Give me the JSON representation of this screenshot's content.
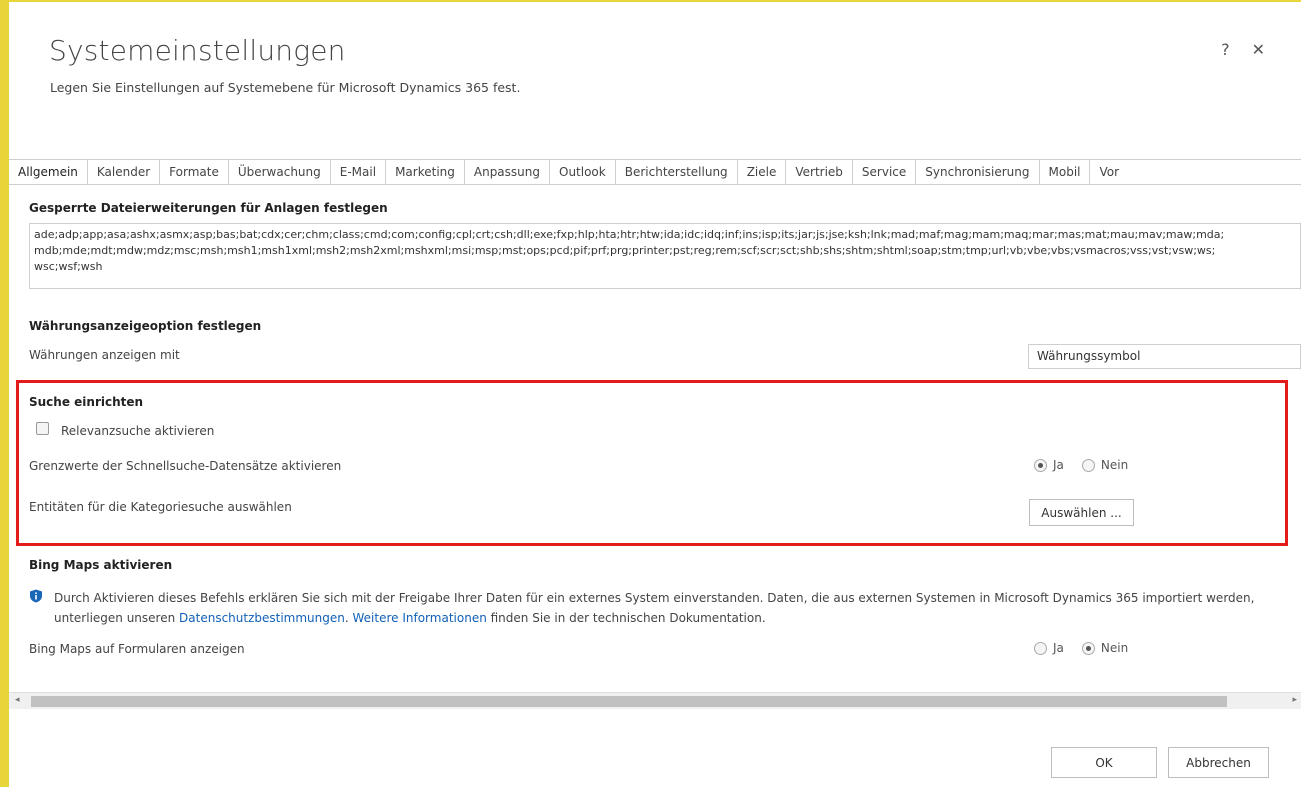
{
  "dialog": {
    "title": "Systemeinstellungen",
    "subtitle": "Legen Sie Einstellungen auf Systemebene für Microsoft Dynamics 365 fest.",
    "help_label": "?",
    "close_label": "✕"
  },
  "tabs": [
    {
      "label": "Allgemein",
      "active": true
    },
    {
      "label": "Kalender"
    },
    {
      "label": "Formate"
    },
    {
      "label": "Überwachung"
    },
    {
      "label": "E-Mail"
    },
    {
      "label": "Marketing"
    },
    {
      "label": "Anpassung"
    },
    {
      "label": "Outlook"
    },
    {
      "label": "Berichterstellung"
    },
    {
      "label": "Ziele"
    },
    {
      "label": "Vertrieb"
    },
    {
      "label": "Service"
    },
    {
      "label": "Synchronisierung"
    },
    {
      "label": "Mobil"
    },
    {
      "label": "Vor"
    }
  ],
  "blocked_extensions": {
    "title": "Gesperrte Dateierweiterungen für Anlagen festlegen",
    "value": "ade;adp;app;asa;ashx;asmx;asp;bas;bat;cdx;cer;chm;class;cmd;com;config;cpl;crt;csh;dll;exe;fxp;hlp;hta;htr;htw;ida;idc;idq;inf;ins;isp;its;jar;js;jse;ksh;lnk;mad;maf;mag;mam;maq;mar;mas;mat;mau;mav;maw;mda;\nmdb;mde;mdt;mdw;mdz;msc;msh;msh1;msh1xml;msh2;msh2xml;mshxml;msi;msp;mst;ops;pcd;pif;prf;prg;printer;pst;reg;rem;scf;scr;sct;shb;shs;shtm;shtml;soap;stm;tmp;url;vb;vbe;vbs;vsmacros;vss;vst;vsw;ws;\nwsc;wsf;wsh"
  },
  "currency": {
    "title": "Währungsanzeigeoption festlegen",
    "label": "Währungen anzeigen mit",
    "selected": "Währungssymbol"
  },
  "search": {
    "title": "Suche einrichten",
    "relevance_label": "Relevanzsuche aktivieren",
    "relevance_checked": false,
    "quickfind_label": "Grenzwerte der Schnellsuche-Datensätze aktivieren",
    "quickfind_yes": "Ja",
    "quickfind_no": "Nein",
    "quickfind_value": "Ja",
    "category_label": "Entitäten für die Kategoriesuche auswählen",
    "select_button": "Auswählen ..."
  },
  "bing": {
    "title": "Bing Maps aktivieren",
    "info_part1": "Durch Aktivieren dieses Befehls erklären Sie sich mit der Freigabe Ihrer Daten für ein externes System einverstanden. Daten, die aus externen Systemen in Microsoft Dynamics 365 importiert werden, unterliegen unseren ",
    "privacy_link": "Datenschutzbestimmungen",
    "info_part2": ". ",
    "more_link": "Weitere Informationen",
    "info_part3": " finden Sie in der technischen Dokumentation.",
    "forms_label": "Bing Maps auf Formularen anzeigen",
    "forms_yes": "Ja",
    "forms_no": "Nein",
    "forms_value": "Nein"
  },
  "footer": {
    "ok_label": "OK",
    "cancel_label": "Abbrechen"
  },
  "colors": {
    "highlight": "#e31b1b",
    "link": "#1160b7",
    "frame": "#e8d53a"
  },
  "icons": {
    "info": "info-shield-icon",
    "scroll_left": "◂",
    "scroll_right": "▸"
  }
}
